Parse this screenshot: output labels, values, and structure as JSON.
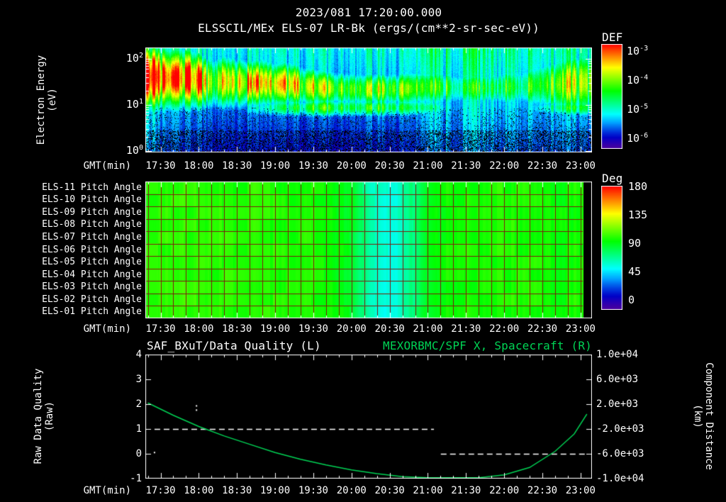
{
  "main_title": "2023/081 17:20:00.000",
  "colors": {
    "background": "#000000",
    "text": "#ffffff",
    "accent_green": "#00d455",
    "grid_red": "#7a1c0c",
    "frame": "#ffffff"
  },
  "time_axis": {
    "label": "GMT(min)",
    "tick_labels": [
      "17:30",
      "18:00",
      "18:30",
      "19:00",
      "19:30",
      "20:00",
      "20:30",
      "21:00",
      "21:30",
      "22:00",
      "22:30",
      "23:00"
    ],
    "tick_hours": [
      17.5,
      18,
      18.5,
      19,
      19.5,
      20,
      20.5,
      21,
      21.5,
      22,
      22.5,
      23
    ],
    "range_hours": [
      17.3,
      23.15
    ]
  },
  "panel1": {
    "title": "ELSSCIL/MEx ELS-07 LR-Bk  (ergs/(cm**2-sr-sec-eV))",
    "ylabel": [
      "Electron Energy",
      "(eV)"
    ],
    "ytick_exponents": [
      2,
      1,
      0
    ],
    "colorbar": {
      "label": "DEF",
      "tick_exponents": [
        -3,
        -4,
        -5,
        -6
      ]
    }
  },
  "panel2": {
    "row_labels": [
      "ELS-11 Pitch Angle",
      "ELS-10 Pitch Angle",
      "ELS-09 Pitch Angle",
      "ELS-08 Pitch Angle",
      "ELS-07 Pitch Angle",
      "ELS-06 Pitch Angle",
      "ELS-05 Pitch Angle",
      "ELS-04 Pitch Angle",
      "ELS-03 Pitch Angle",
      "ELS-02 Pitch Angle",
      "ELS-01 Pitch Angle"
    ],
    "colorbar": {
      "label": "Deg",
      "tick_labels": [
        "180",
        "135",
        "90",
        "45",
        "0"
      ]
    }
  },
  "panel3": {
    "title_left": "SAF_BXuT/Data Quality (L)",
    "title_right": "MEXORBMC/SPF X, Spacecraft (R)",
    "ylabel_left": [
      "Raw Data Quality",
      "(Raw)"
    ],
    "ylabel_right": [
      "Component Distance",
      "(km)"
    ],
    "yticks_left": [
      "4",
      "3",
      "2",
      "1",
      "0",
      "-1"
    ],
    "yticks_right": [
      "1.0e+04",
      "6.0e+03",
      "2.0e+03",
      "-2.0e+03",
      "-6.0e+03",
      "-1.0e+04"
    ]
  },
  "chart_data": [
    {
      "type": "heatmap",
      "name": "electron-energy-spectrogram",
      "title": "ELSSCIL/MEx ELS-07 LR-Bk",
      "units": "ergs/(cm**2-sr-sec-eV)",
      "xlabel": "GMT(min)",
      "ylabel": "Electron Energy (eV)",
      "x_range_hours": [
        17.3,
        23.15
      ],
      "y_log10_range_ev": [
        -0.03,
        2.246
      ],
      "color_log10_range": [
        -6,
        -3
      ],
      "t0_hours": 17.3333,
      "dt_hours": 0.166667,
      "band_center_log_ev": [
        1.62,
        1.6,
        1.58,
        1.6,
        1.55,
        1.5,
        1.52,
        1.5,
        1.48,
        1.5,
        1.45,
        1.48,
        1.42,
        1.4,
        1.38,
        1.36,
        1.35,
        1.35,
        1.35,
        1.35,
        1.35,
        1.38,
        1.4,
        1.4,
        1.38,
        1.38,
        1.38,
        1.38,
        1.4,
        1.4,
        1.42,
        1.45,
        1.45,
        1.48,
        1.5
      ],
      "band_peak": [
        1.0,
        0.97,
        0.92,
        0.98,
        0.9,
        0.62,
        0.88,
        0.8,
        0.78,
        0.82,
        0.72,
        0.8,
        0.68,
        0.66,
        0.63,
        0.62,
        0.62,
        0.6,
        0.62,
        0.6,
        0.63,
        0.6,
        0.52,
        0.58,
        0.52,
        0.48,
        0.55,
        0.5,
        0.56,
        0.5,
        0.56,
        0.6,
        0.68,
        0.7,
        0.68
      ],
      "band_width_log": [
        0.5,
        0.48,
        0.46,
        0.46,
        0.42,
        0.4,
        0.4,
        0.38,
        0.36,
        0.36,
        0.34,
        0.34,
        0.32,
        0.3,
        0.28,
        0.27,
        0.27,
        0.27,
        0.27,
        0.27,
        0.28,
        0.28,
        0.3,
        0.3,
        0.3,
        0.3,
        0.3,
        0.3,
        0.32,
        0.32,
        0.34,
        0.38,
        0.44,
        0.48,
        0.5
      ],
      "lowband_center_log_ev": 0.95,
      "lowband_width_log": 0.15,
      "lowband_peak": [
        0,
        0,
        0,
        0,
        0,
        0,
        0.1,
        0.2,
        0.3,
        0.35,
        0.42,
        0.45,
        0.46,
        0.5,
        0.52,
        0.52,
        0.52,
        0.5,
        0.5,
        0.5,
        0.48,
        0.45,
        0.4,
        0.36,
        0.32,
        0.3,
        0.3,
        0.3,
        0.3,
        0.3,
        0.3,
        0.36,
        0.46,
        0.5,
        0.5
      ],
      "background_wash": [
        0.14,
        0.1,
        0.1,
        0.08,
        0.06,
        0.05,
        0.06,
        0.05,
        0.04,
        0.04,
        0.04,
        0.04,
        0.03,
        0.03,
        0.03,
        0.03,
        0.05,
        0.05,
        0.05,
        0.05,
        0.05,
        0.06,
        0.12,
        0.14,
        0.12,
        0.14,
        0.16,
        0.14,
        0.12,
        0.14,
        0.12,
        0.1,
        0.14,
        0.12,
        0.1
      ]
    },
    {
      "type": "heatmap",
      "name": "pitch-angle-panels",
      "rows": 11,
      "row_labels_ref": "panel2.row_labels",
      "value_range_deg": [
        0,
        180
      ],
      "t0_hours": 17.3333,
      "dt_hours": 0.166667,
      "pitch_deg": [
        108,
        107,
        108,
        106,
        107,
        106,
        106,
        105,
        106,
        105,
        105,
        104,
        104,
        104,
        102,
        99,
        93,
        79,
        67,
        65,
        70,
        83,
        96,
        101,
        103,
        104,
        104,
        104,
        105,
        104,
        104,
        103,
        100,
        102,
        104
      ],
      "no_data_after_hours": 23.03
    },
    {
      "type": "line",
      "name": "quality-and-spacecraft-x",
      "ylim_left": [
        -1,
        4
      ],
      "ylim_right_km": [
        -10000,
        10000
      ],
      "series": [
        {
          "name": "SAF_BXuT/Data Quality",
          "axis": "left",
          "style": "dashed",
          "color": "#ffffff",
          "segments": [
            {
              "t": [
                17.42,
                21.08
              ],
              "value": 1
            },
            {
              "t": [
                21.17,
                23.08
              ],
              "value": 0
            }
          ],
          "points": [
            [
              17.97,
              1.93
            ],
            [
              17.97,
              1.76
            ],
            [
              17.42,
              0.05
            ]
          ]
        },
        {
          "name": "MEXORBMC/SPF X, Spacecraft",
          "axis": "right",
          "style": "solid",
          "color": "#00d455",
          "t": [
            17.333,
            17.667,
            18.0,
            18.333,
            18.667,
            19.0,
            19.333,
            19.667,
            20.0,
            20.333,
            20.667,
            21.0,
            21.333,
            21.667,
            22.0,
            22.333,
            22.667,
            22.917,
            23.083
          ],
          "km": [
            2200,
            200,
            -1600,
            -3120,
            -4480,
            -5800,
            -6880,
            -7800,
            -8600,
            -9200,
            -9680,
            -9920,
            -10000,
            -9880,
            -9400,
            -8200,
            -5600,
            -2800,
            400
          ]
        }
      ]
    }
  ]
}
